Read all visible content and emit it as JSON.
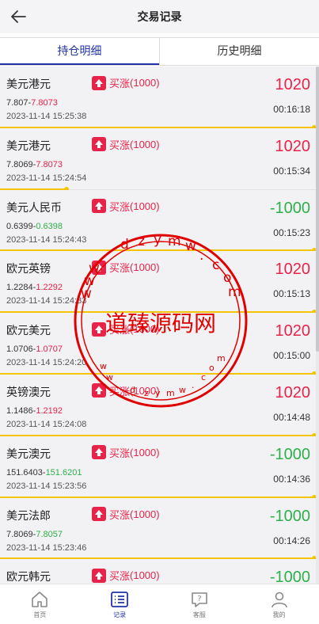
{
  "header": {
    "title": "交易记录",
    "back_icon": "arrow-left-icon"
  },
  "tabs": [
    {
      "label": "持仓明细",
      "active": true
    },
    {
      "label": "历史明细",
      "active": false
    }
  ],
  "trades": [
    {
      "name": "美元港元",
      "direction": "买涨",
      "amount": "(1000)",
      "open": "7.807",
      "close": "7.8073",
      "close_dir": "up",
      "datetime": "2023-11-14 15:25:38",
      "pnl": "1020",
      "pnl_dir": "profit",
      "countdown": "00:16:18",
      "progress": 1.0
    },
    {
      "name": "美元港元",
      "direction": "买涨",
      "amount": "(1000)",
      "open": "7.8069",
      "close": "7.8073",
      "close_dir": "up",
      "datetime": "2023-11-14 15:24:54",
      "pnl": "1020",
      "pnl_dir": "profit",
      "countdown": "00:15:34",
      "progress": 0.21
    },
    {
      "name": "美元人民币",
      "direction": "买涨",
      "amount": "(1000)",
      "open": "0.6399",
      "close": "0.6398",
      "close_dir": "down",
      "datetime": "2023-11-14 15:24:43",
      "pnl": "-1000",
      "pnl_dir": "loss",
      "countdown": "00:15:23",
      "progress": 1.0
    },
    {
      "name": "欧元英镑",
      "direction": "买涨",
      "amount": "(1000)",
      "open": "1.2284",
      "close": "1.2292",
      "close_dir": "up",
      "datetime": "2023-11-14 15:24:33",
      "pnl": "1020",
      "pnl_dir": "profit",
      "countdown": "00:15:13",
      "progress": 1.0
    },
    {
      "name": "欧元美元",
      "direction": "买涨",
      "amount": "(1000)",
      "open": "1.0706",
      "close": "1.0707",
      "close_dir": "up",
      "datetime": "2023-11-14 15:24:20",
      "pnl": "1020",
      "pnl_dir": "profit",
      "countdown": "00:15:00",
      "progress": 1.0
    },
    {
      "name": "英镑澳元",
      "direction": "买涨",
      "amount": "(1000)",
      "open": "1.1486",
      "close": "1.2192",
      "close_dir": "up",
      "datetime": "2023-11-14 15:24:08",
      "pnl": "1020",
      "pnl_dir": "profit",
      "countdown": "00:14:48",
      "progress": 1.0
    },
    {
      "name": "美元澳元",
      "direction": "买涨",
      "amount": "(1000)",
      "open": "151.6403",
      "close": "151.6201",
      "close_dir": "down",
      "datetime": "2023-11-14 15:23:56",
      "pnl": "-1000",
      "pnl_dir": "loss",
      "countdown": "00:14:36",
      "progress": 1.0
    },
    {
      "name": "美元法郎",
      "direction": "买涨",
      "amount": "(1000)",
      "open": "7.8069",
      "close": "7.8057",
      "close_dir": "down",
      "datetime": "2023-11-14 15:23:46",
      "pnl": "-1000",
      "pnl_dir": "loss",
      "countdown": "00:14:26",
      "progress": 1.0
    },
    {
      "name": "欧元韩元",
      "direction": "买涨",
      "amount": "(1000)",
      "open": "",
      "close": "",
      "close_dir": "down",
      "datetime": "",
      "pnl": "-1000",
      "pnl_dir": "loss",
      "countdown": "",
      "progress": 0.0
    }
  ],
  "nav": [
    {
      "label": "首页",
      "icon": "home-icon",
      "active": false
    },
    {
      "label": "记录",
      "icon": "list-icon",
      "active": true
    },
    {
      "label": "客服",
      "icon": "chat-help-icon",
      "active": false
    },
    {
      "label": "我的",
      "icon": "user-icon",
      "active": false
    }
  ],
  "watermark": {
    "text": "道臻源码网",
    "url_text": "dzymw.com"
  },
  "colors": {
    "accent": "#2233aa",
    "profit": "#e8234a",
    "loss": "#2db04a",
    "progress": "#f5c400",
    "stamp": "#e00000"
  }
}
